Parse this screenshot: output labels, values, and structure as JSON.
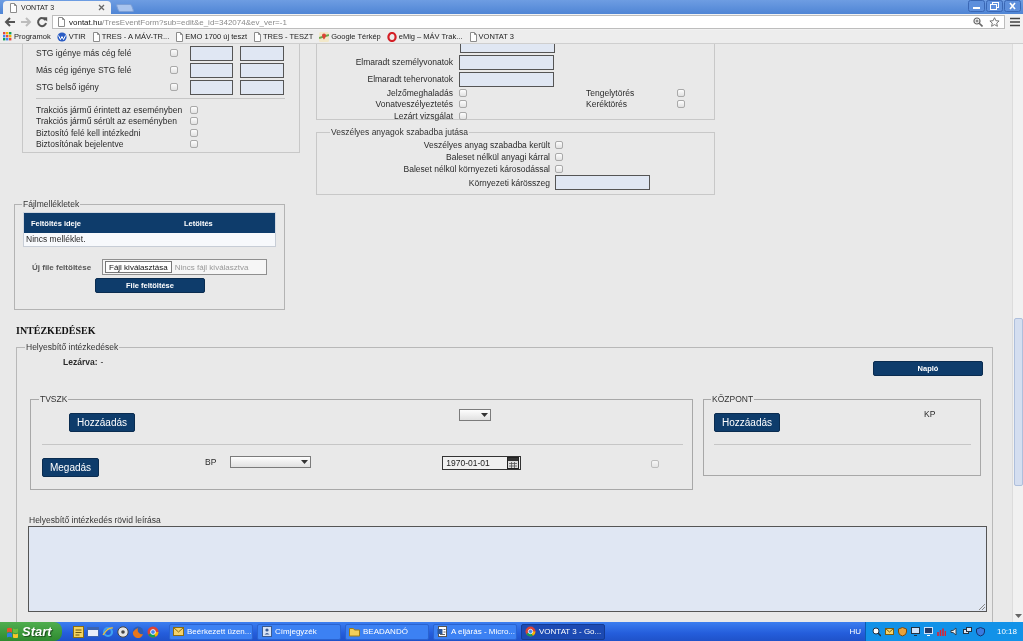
{
  "browser": {
    "tabs": [
      {
        "title": "VONTAT 3",
        "selected": true
      }
    ],
    "nav_buttons": [
      {
        "kind": "back",
        "disabled": false
      },
      {
        "kind": "forward",
        "disabled": true
      },
      {
        "kind": "reload",
        "disabled": false
      }
    ],
    "url": {
      "host": "vontat.hu",
      "path": "/TresEventForm?sub=edit&e_id=342074&ev_ver=-1"
    },
    "bookmarks": [
      {
        "label": "Programok",
        "kind": "apps"
      },
      {
        "label": "VTIR",
        "kind": "globe"
      },
      {
        "label": "TRES - A MÁV-TR...",
        "kind": "page"
      },
      {
        "label": "EMO 1700 új teszt",
        "kind": "page"
      },
      {
        "label": "TRES - TESZT",
        "kind": "page"
      },
      {
        "label": "Google Térkép",
        "kind": "map"
      },
      {
        "label": "eMig – MÁV Trak...",
        "kind": "ring"
      },
      {
        "label": "VONTAT 3",
        "kind": "page"
      }
    ]
  },
  "claims_panel": {
    "rows": [
      {
        "label": "STG igénye más cég felé",
        "checked": false
      },
      {
        "label": "Más cég igénye STG felé",
        "checked": false
      },
      {
        "label": "STG belső igény",
        "checked": false
      }
    ],
    "flags": [
      {
        "label": "Trakciós jármű érintett az eseményben",
        "checked": false
      },
      {
        "label": "Trakciós jármű sérült az eseményben",
        "checked": false
      },
      {
        "label": "Biztosító felé kell intézkedni",
        "checked": false
      },
      {
        "label": "Biztosítónak bejelentve",
        "checked": false
      }
    ]
  },
  "damage_panel": {
    "fields": [
      {
        "kind": "cut"
      },
      {
        "kind": "labeled",
        "label": "Elmaradt személyvonatok"
      },
      {
        "kind": "labeled",
        "label": "Elmaradt tehervonatok"
      }
    ],
    "flags": [
      {
        "label": "Jelzőmeghaladás",
        "checked": false
      },
      {
        "label": "Tengelytörés",
        "checked": false
      },
      {
        "label": "Vonatveszélyeztetés",
        "checked": false
      },
      {
        "label": "Keréktörés",
        "checked": false
      },
      {
        "label": "Lezárt vizsgálat",
        "checked": false
      }
    ]
  },
  "hazmat_panel": {
    "title": "Veszélyes anyagok szabadba jutása",
    "flags": [
      {
        "label": "Veszélyes anyag szabadba került",
        "checked": false
      },
      {
        "label": "Baleset nélkül anyagi kárral",
        "checked": false
      },
      {
        "label": "Baleset nélkül környezeti károsodással",
        "checked": false
      }
    ],
    "amount_label": "Környezeti kárösszeg"
  },
  "attachments": {
    "title": "Fájlmellékletek",
    "columns": [
      "Feltöltés ideje",
      "Letöltés"
    ],
    "empty_text": "Nincs melléklet.",
    "upload_label": "Új file feltöltése",
    "choose_button": "Fájl kiválasztása",
    "file_status": "Nincs fájl kiválasztva",
    "upload_button": "File feltöltése"
  },
  "measures": {
    "heading": "INTÉZKEDÉSEK",
    "title": "Helyesbítő intézkedések",
    "closed_label": "Lezárva:",
    "closed_value": "-",
    "log_button": "Napló",
    "tvszk": {
      "title": "TVSZK",
      "add_button": "Hozzáadás",
      "submit_button": "Megadás",
      "bp_label": "BP",
      "date": "1970-01-01",
      "checked": false
    },
    "center": {
      "title": "KÖZPONT",
      "add_button": "Hozzáadás",
      "kp_label": "KP"
    },
    "description_label": "Helyesbítő intézkedés rövid leírása"
  },
  "taskbar": {
    "start": "Start",
    "tasks": [
      {
        "label": "Beérkezett üzen...",
        "kind": "mail",
        "selected": false
      },
      {
        "label": "Címjegyzék",
        "kind": "contacts",
        "selected": false
      },
      {
        "label": "BEADANDÓ",
        "kind": "folder",
        "selected": false
      },
      {
        "label": "A eljárás - Micro...",
        "kind": "document",
        "selected": false
      },
      {
        "label": "VONTAT 3 - Go...",
        "kind": "browser",
        "selected": true
      }
    ],
    "language": "HU",
    "time": "10:18"
  }
}
